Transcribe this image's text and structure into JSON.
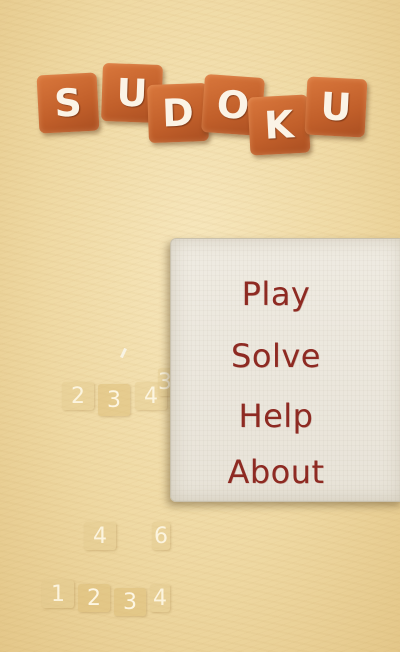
{
  "title": {
    "letters": [
      "S",
      "U",
      "D",
      "O",
      "K",
      "U"
    ]
  },
  "menu": {
    "items": [
      {
        "label": "Play"
      },
      {
        "label": "Solve"
      },
      {
        "label": "Help"
      },
      {
        "label": "About"
      }
    ]
  },
  "board": {
    "visible_digits": [
      "2",
      "3",
      "4",
      "3",
      "4",
      "6",
      "1",
      "2",
      "3",
      "4"
    ]
  },
  "colors": {
    "tile": "#c8652e",
    "menu_text": "#8e2a22",
    "background": "#efd9a3"
  }
}
